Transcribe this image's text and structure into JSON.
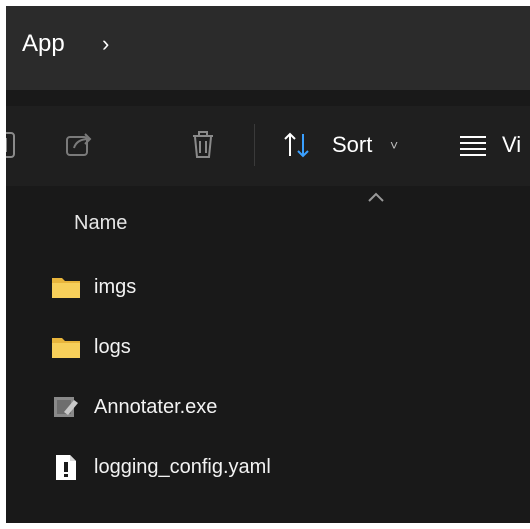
{
  "address_bar": {
    "crumb_label": "App",
    "separator": "›"
  },
  "toolbar": {
    "sort_label": "Sort",
    "sort_chevron": "˅",
    "view_label": "Vi"
  },
  "file_list": {
    "column_name": "Name",
    "items": [
      {
        "name": "imgs",
        "icon": "folder-icon"
      },
      {
        "name": "logs",
        "icon": "folder-icon"
      },
      {
        "name": "Annotater.exe",
        "icon": "exe-icon"
      },
      {
        "name": "logging_config.yaml",
        "icon": "yaml-file-icon"
      }
    ]
  },
  "colors": {
    "window_bg": "#191919",
    "address_bg": "#2b2b2b",
    "toolbar_bg": "#1f1f1f",
    "folder": "#f2c94c"
  }
}
